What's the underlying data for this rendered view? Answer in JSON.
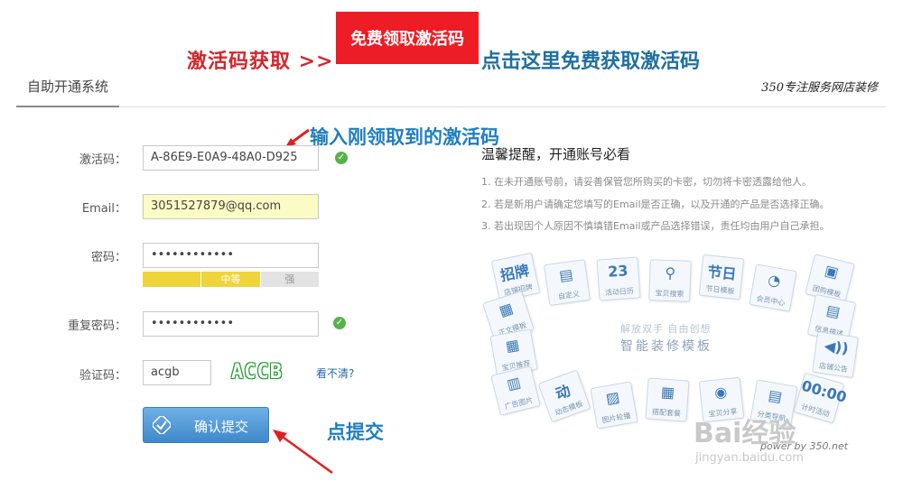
{
  "promo": {
    "left_label": "激活码获取 >>",
    "button_label": "免费领取激活码",
    "right_label": "点击这里免费获取激活码"
  },
  "header": {
    "tab_label": "自助开通系统",
    "brand_text": "350专注服务网店装修"
  },
  "annotations": {
    "code_hint": "输入刚领取到的激活码",
    "submit_hint": "点提交"
  },
  "form": {
    "code_label": "激活码：",
    "code_value": "A-86E9-E0A9-48A0-D925",
    "email_label": "Email：",
    "email_value": "3051527879@qq.com",
    "password_label": "密码：",
    "password_value": "••••••••••••",
    "strength": {
      "weak": "",
      "medium": "中等",
      "strong": "强",
      "level": 0.67
    },
    "confirm_label": "重复密码：",
    "confirm_value": "••••••••••••",
    "captcha_label": "验证码：",
    "captcha_value": "acgb",
    "captcha_image_text": "ACCB",
    "captcha_refresh": "看不清?",
    "submit_label": "确认提交"
  },
  "tips": {
    "title": "温馨提醒，开通账号必看",
    "items": [
      "1. 在未开通账号前，请妥善保管您所购买的卡密，切勿将卡密透露给他人。",
      "2. 若是新用户请确定您填写的Email是否正确，以及开通的产品是否选择正确。",
      "3. 若出现因个人原因不慎填错Email或产品选择错误，责任均由用户自己承担。"
    ]
  },
  "graphic": {
    "center_subtitle": "解放双手 自由创想",
    "center_title": "智能装修模板",
    "tiles": [
      {
        "glyph": "招牌",
        "caption": "店铺招牌"
      },
      {
        "glyph": "▤",
        "caption": "自定义"
      },
      {
        "glyph": "23",
        "caption": "活动日历"
      },
      {
        "glyph": "⚲",
        "caption": "宝贝搜索"
      },
      {
        "glyph": "节日",
        "caption": "节日模板"
      },
      {
        "glyph": "◔",
        "caption": "会员中心"
      },
      {
        "glyph": "▣",
        "caption": "团购模板"
      },
      {
        "glyph": "▦",
        "caption": "正文模板"
      },
      {
        "glyph": "▤",
        "caption": "信息描述"
      },
      {
        "glyph": "▦",
        "caption": "宝贝推荐"
      },
      {
        "glyph": "◀))",
        "caption": "店铺公告"
      },
      {
        "glyph": "▥",
        "caption": "广告图片"
      },
      {
        "glyph": "动",
        "caption": "动态模板"
      },
      {
        "glyph": "▨",
        "caption": "图片轮播"
      },
      {
        "glyph": "▦",
        "caption": "搭配套餐"
      },
      {
        "glyph": "◉",
        "caption": "宝贝分享"
      },
      {
        "glyph": "▤",
        "caption": "分类导航"
      },
      {
        "glyph": "00:00",
        "caption": "计时活动"
      }
    ],
    "powered_by": "power by 350.net"
  },
  "watermark": {
    "logo_text": "Bai经验",
    "url_text": "jingyan.baidu.com"
  }
}
